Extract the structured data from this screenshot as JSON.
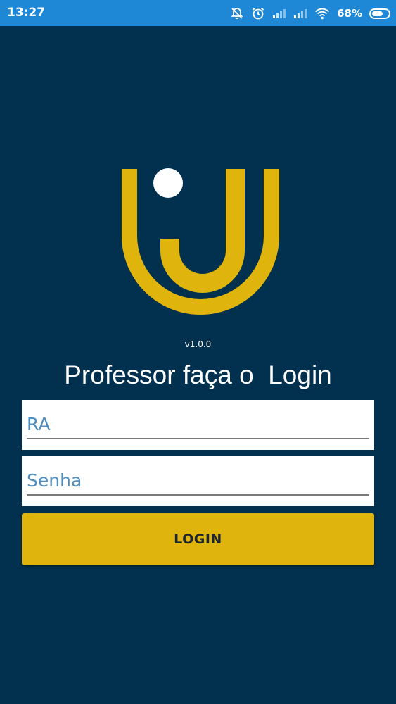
{
  "status_bar": {
    "time": "13:27",
    "battery_percent": "68%",
    "battery_level": 0.68,
    "icons": [
      "bell-off-icon",
      "alarm-icon",
      "signal-icon",
      "signal-icon",
      "wifi-icon",
      "battery-icon"
    ]
  },
  "branding": {
    "logo": "logo-icon",
    "logo_color": "#dfb40d",
    "version": "v1.0.0"
  },
  "login": {
    "title": "Professor faça o  Login",
    "ra_placeholder": "RA",
    "ra_value": "",
    "password_placeholder": "Senha",
    "password_value": "",
    "button_label": "LOGIN"
  },
  "colors": {
    "background": "#02304f",
    "status_bar": "#1e88d6",
    "accent": "#dfb40d",
    "placeholder": "#4f8dbf"
  }
}
